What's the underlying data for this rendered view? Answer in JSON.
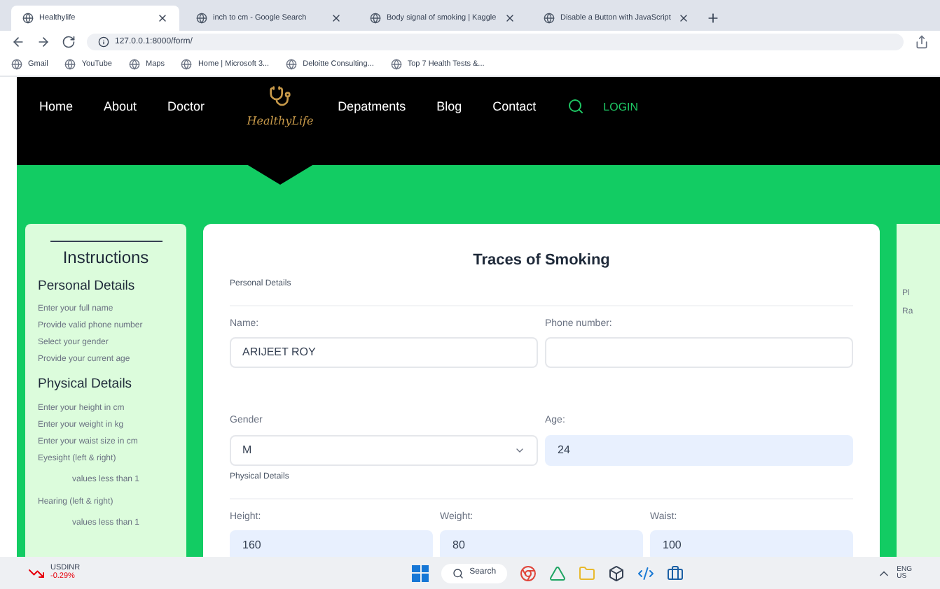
{
  "browser": {
    "tabs": [
      {
        "title": "Healthylife",
        "selected": true
      },
      {
        "title": "inch to cm - Google Search",
        "selected": false
      },
      {
        "title": "Body signal of smoking | Kaggle",
        "selected": false
      },
      {
        "title": "Disable a Button with JavaScript",
        "selected": false
      }
    ],
    "address": "127.0.0.1:8000/form/",
    "bookmarks": [
      "Gmail",
      "YouTube",
      "Maps",
      "Home | Microsoft 3...",
      "Deloitte Consulting...",
      "Top 7 Health Tests &..."
    ]
  },
  "nav": {
    "left": [
      {
        "label": "Home"
      },
      {
        "label": "About"
      },
      {
        "label": "Doctor"
      }
    ],
    "logo": "HealthyLife",
    "right": [
      {
        "label": "Depatments",
        "kind": "link"
      },
      {
        "label": "Blog",
        "kind": "link"
      },
      {
        "label": "Contact",
        "kind": "link"
      },
      {
        "kind": "search"
      },
      {
        "label": "LOGIN",
        "kind": "login"
      }
    ]
  },
  "instructions": {
    "title": "Instructions",
    "sections": [
      {
        "heading": "Personal Details",
        "items": [
          {
            "text": "Enter your full name",
            "kind": "step"
          },
          {
            "text": "Provide valid phone number",
            "kind": "step"
          },
          {
            "text": "Select your gender",
            "kind": "step"
          },
          {
            "text": "Provide your current age",
            "kind": "step"
          }
        ]
      },
      {
        "heading": "Physical Details",
        "items": [
          {
            "text": "Enter your height in cm",
            "kind": "step"
          },
          {
            "text": "Enter your weight in kg",
            "kind": "step"
          },
          {
            "text": "Enter your waist size in cm",
            "kind": "step"
          },
          {
            "text": "Eyesight (left & right)",
            "kind": "step"
          },
          {
            "text": "values less than 1",
            "kind": "note"
          },
          {
            "text": "Hearing (left & right)",
            "kind": "step"
          },
          {
            "text": "values less than 1",
            "kind": "note"
          }
        ]
      }
    ]
  },
  "form": {
    "title": "Traces of Smoking",
    "sections": [
      {
        "heading": "Personal Details",
        "rows": [
          [
            {
              "label": "Name:",
              "value": "ARIJEET ROY",
              "kind": "text",
              "autofilled": false
            },
            {
              "label": "Phone number:",
              "kind": "text",
              "autofilled": false
            }
          ],
          [
            {
              "label": "Gender",
              "value": "M",
              "kind": "select",
              "autofilled": false
            },
            {
              "label": "Age:",
              "value": "24",
              "kind": "text",
              "autofilled": true
            }
          ]
        ]
      },
      {
        "heading": "Physical Details",
        "rows": [
          [
            {
              "label": "Height:",
              "value": "160",
              "kind": "text",
              "autofilled": true
            },
            {
              "label": "Weight:",
              "value": "80",
              "kind": "text",
              "autofilled": true
            },
            {
              "label": "Waist:",
              "value": "100",
              "kind": "text",
              "autofilled": true
            }
          ]
        ]
      }
    ]
  },
  "right_panel": {
    "lines": [
      "Pl",
      "Ra"
    ]
  },
  "taskbar": {
    "ticker": {
      "symbol": "USDINR",
      "change": "-0.29%"
    },
    "search": "Search",
    "language": [
      "ENG",
      "US"
    ]
  }
}
